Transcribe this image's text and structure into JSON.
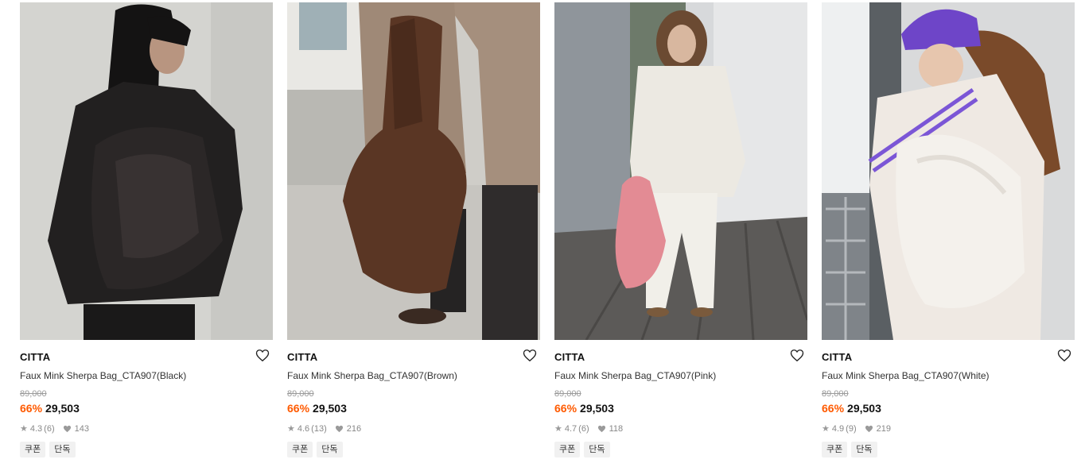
{
  "products": [
    {
      "brand": "CITTA",
      "name": "Faux Mink Sherpa Bag_CTA907(Black)",
      "original_price": "89,000",
      "discount": "66%",
      "sale_price": "29,503",
      "rating": "4.3",
      "reviews": "(6)",
      "likes": "143",
      "tags": [
        "쿠폰",
        "단독"
      ],
      "image_theme": {
        "bg": "#d6d6d2",
        "accent": "#1c1a1a"
      }
    },
    {
      "brand": "CITTA",
      "name": "Faux Mink Sherpa Bag_CTA907(Brown)",
      "original_price": "89,000",
      "discount": "66%",
      "sale_price": "29,503",
      "rating": "4.6",
      "reviews": "(13)",
      "likes": "216",
      "tags": [
        "쿠폰",
        "단독"
      ],
      "image_theme": {
        "bg": "#c9c6c1",
        "accent": "#5b3524"
      }
    },
    {
      "brand": "CITTA",
      "name": "Faux Mink Sherpa Bag_CTA907(Pink)",
      "original_price": "89,000",
      "discount": "66%",
      "sale_price": "29,503",
      "rating": "4.7",
      "reviews": "(6)",
      "likes": "118",
      "tags": [
        "쿠폰",
        "단독"
      ],
      "image_theme": {
        "bg": "#cfd2d4",
        "accent": "#e48a92"
      }
    },
    {
      "brand": "CITTA",
      "name": "Faux Mink Sherpa Bag_CTA907(White)",
      "original_price": "89,000",
      "discount": "66%",
      "sale_price": "29,503",
      "rating": "4.9",
      "reviews": "(9)",
      "likes": "219",
      "tags": [
        "쿠폰",
        "단독"
      ],
      "image_theme": {
        "bg": "#d8d9da",
        "accent": "#ece8e3"
      }
    }
  ],
  "colors": {
    "discount": "#ff5a00",
    "tag_bg": "#f1f1f1",
    "muted": "#888888"
  },
  "icons": {
    "wishlist": "heart-outline-icon",
    "rating": "star-icon",
    "likes": "heart-filled-icon"
  }
}
